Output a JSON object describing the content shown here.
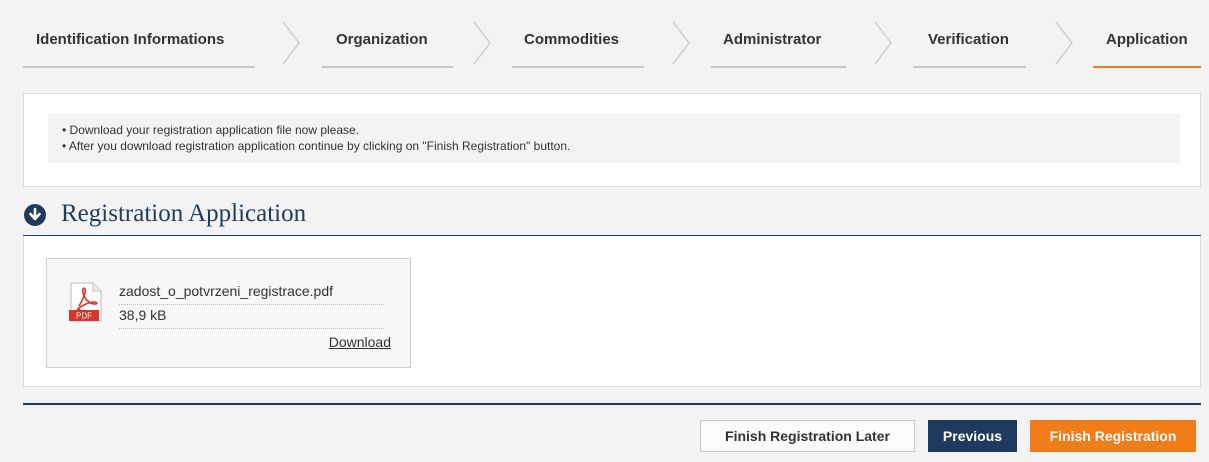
{
  "wizard": {
    "steps": [
      {
        "label": "Identification Informations",
        "active": false
      },
      {
        "label": "Organization",
        "active": false
      },
      {
        "label": "Commodities",
        "active": false
      },
      {
        "label": "Administrator",
        "active": false
      },
      {
        "label": "Verification",
        "active": false
      },
      {
        "label": "Application",
        "active": true
      }
    ]
  },
  "info": {
    "lines": [
      "• Download your registration application file now please.",
      "• After you download registration application continue by clicking on \"Finish Registration\" button."
    ]
  },
  "section": {
    "title": "Registration Application",
    "icon": "arrow-down-circle-icon"
  },
  "file": {
    "name": "zadost_o_potvrzeni_registrace.pdf",
    "size": "38,9 kB",
    "download_label": "Download",
    "icon": "pdf-file-icon",
    "icon_text": "PDF"
  },
  "buttons": {
    "later": "Finish Registration Later",
    "previous": "Previous",
    "finish": "Finish Registration"
  },
  "colors": {
    "accent": "#f07d1a",
    "navy": "#1f3a5f"
  }
}
